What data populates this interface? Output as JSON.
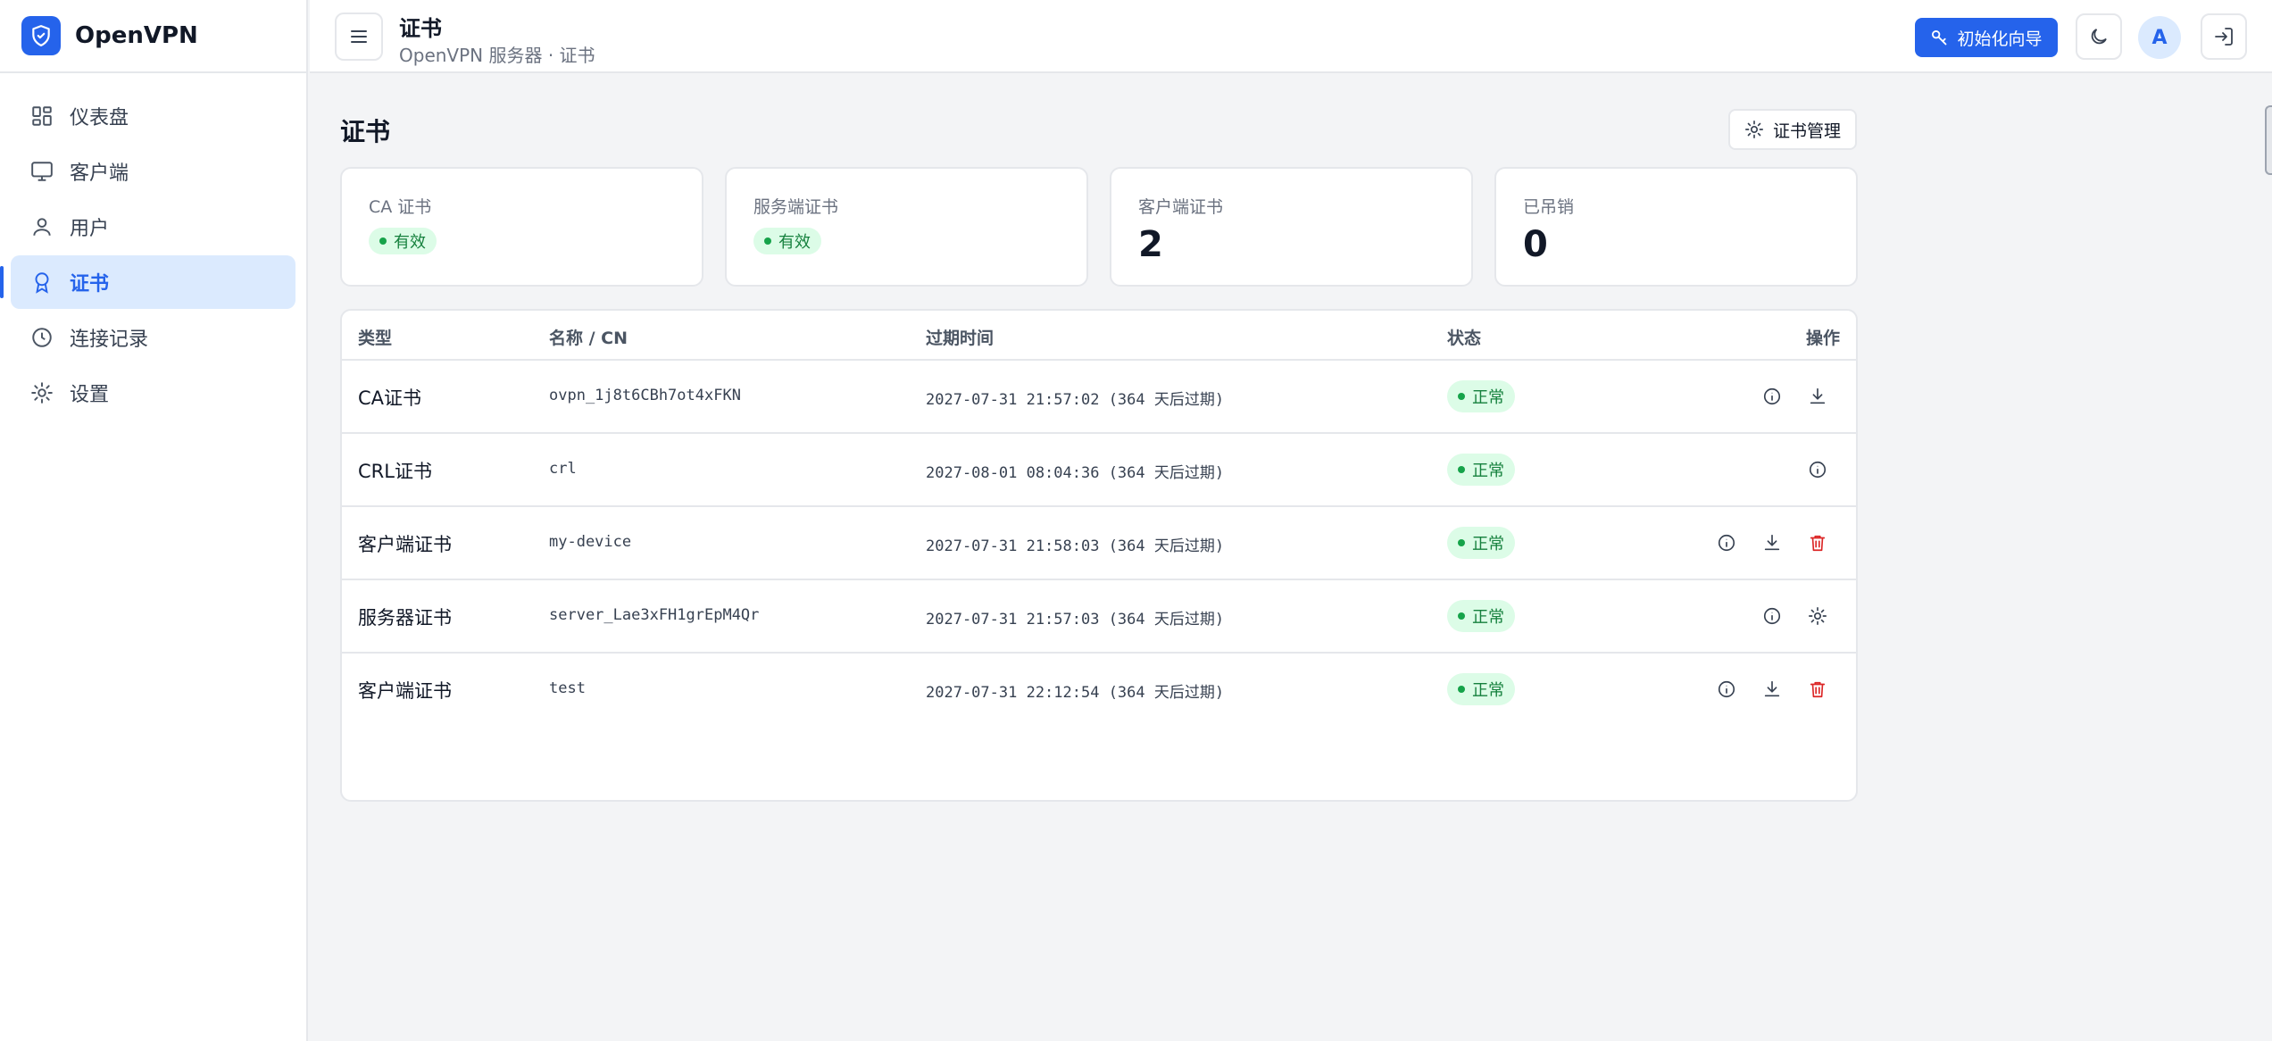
{
  "brand": {
    "name": "OpenVPN"
  },
  "sidebar": {
    "items": [
      {
        "label": "仪表盘",
        "icon": "dashboard-icon"
      },
      {
        "label": "客户端",
        "icon": "monitor-icon"
      },
      {
        "label": "用户",
        "icon": "user-icon"
      },
      {
        "label": "证书",
        "icon": "badge-icon",
        "active": true
      },
      {
        "label": "连接记录",
        "icon": "clock-icon"
      },
      {
        "label": "设置",
        "icon": "gear-icon"
      }
    ]
  },
  "header": {
    "title": "证书",
    "subtitle": "OpenVPN 服务器 · 证书",
    "wizard_label": "初始化向导",
    "avatar_initial": "A"
  },
  "page": {
    "title": "证书",
    "manage_label": "证书管理"
  },
  "cards": [
    {
      "label": "CA 证书",
      "status": "有效"
    },
    {
      "label": "服务端证书",
      "status": "有效"
    },
    {
      "label": "客户端证书",
      "value": "2"
    },
    {
      "label": "已吊销",
      "value": "0"
    }
  ],
  "table": {
    "headers": {
      "type": "类型",
      "cn": "名称 / CN",
      "expire": "过期时间",
      "status": "状态",
      "actions": "操作"
    },
    "rows": [
      {
        "type": "CA证书",
        "cn": "ovpn_1j8t6CBh7ot4xFKN",
        "expire": "2027-07-31 21:57:02 (364 天后过期)",
        "status": "正常",
        "actions": [
          "info",
          "download"
        ]
      },
      {
        "type": "CRL证书",
        "cn": "crl",
        "expire": "2027-08-01 08:04:36 (364 天后过期)",
        "status": "正常",
        "actions": [
          "info"
        ]
      },
      {
        "type": "客户端证书",
        "cn": "my-device",
        "expire": "2027-07-31 21:58:03 (364 天后过期)",
        "status": "正常",
        "actions": [
          "info",
          "download",
          "delete"
        ]
      },
      {
        "type": "服务器证书",
        "cn": "server_Lae3xFH1grEpM4Qr",
        "expire": "2027-07-31 21:57:03 (364 天后过期)",
        "status": "正常",
        "actions": [
          "info",
          "settings"
        ]
      },
      {
        "type": "客户端证书",
        "cn": "test",
        "expire": "2027-07-31 22:12:54 (364 天后过期)",
        "status": "正常",
        "actions": [
          "info",
          "download",
          "delete"
        ]
      }
    ]
  },
  "colors": {
    "accent": "#2563eb",
    "success_bg": "#dcfce7",
    "success_text": "#15803d",
    "danger": "#dc2626"
  }
}
